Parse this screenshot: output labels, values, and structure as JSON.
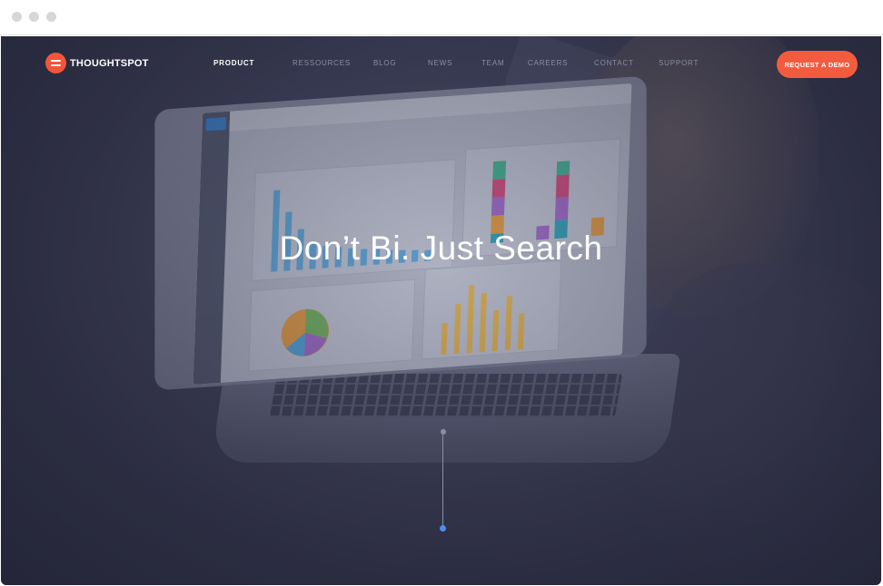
{
  "brand": {
    "name": "THOUGHTSPOT"
  },
  "nav": {
    "items": [
      {
        "label": "PRODUCT",
        "active": true
      },
      {
        "label": "RESSOURCES"
      },
      {
        "label": "BLOG"
      },
      {
        "label": "NEWS"
      },
      {
        "label": "TEAM"
      },
      {
        "label": "CAREERS"
      },
      {
        "label": "CONTACT"
      },
      {
        "label": "SUPPORT"
      }
    ],
    "cta_label": "REQUEST A DEMO"
  },
  "hero": {
    "headline": "Don’t Bi. Just Search"
  },
  "colors": {
    "accent": "#f35b3f",
    "scroll_indicator": "#4a8ff0"
  }
}
